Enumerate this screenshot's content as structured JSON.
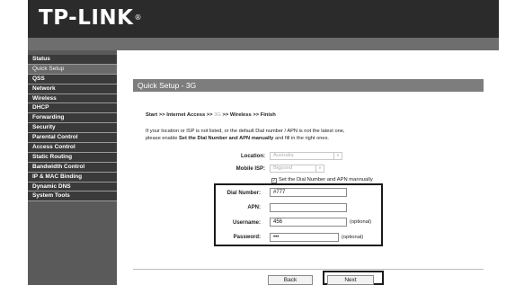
{
  "header": {
    "logo_text": "TP-LINK",
    "logo_mark": "®"
  },
  "sidebar": {
    "items": [
      {
        "label": "Status",
        "selected": false
      },
      {
        "label": "Quick Setup",
        "selected": true
      },
      {
        "label": "QSS",
        "selected": false
      },
      {
        "label": "Network",
        "selected": false
      },
      {
        "label": "Wireless",
        "selected": false
      },
      {
        "label": "DHCP",
        "selected": false
      },
      {
        "label": "Forwarding",
        "selected": false
      },
      {
        "label": "Security",
        "selected": false
      },
      {
        "label": "Parental Control",
        "selected": false
      },
      {
        "label": "Access Control",
        "selected": false
      },
      {
        "label": "Static Routing",
        "selected": false
      },
      {
        "label": "Bandwidth Control",
        "selected": false
      },
      {
        "label": "IP & MAC Binding",
        "selected": false
      },
      {
        "label": "Dynamic DNS",
        "selected": false
      },
      {
        "label": "System Tools",
        "selected": false
      }
    ]
  },
  "page": {
    "title": "Quick Setup - 3G",
    "breadcrumb": {
      "start": "Start",
      "sep1": " >> ",
      "internet": "Internet Access",
      "sep2": " >> ",
      "current": "3G",
      "sep3": " >> ",
      "wireless": "Wireless",
      "sep4": " >> ",
      "finish": "Finish"
    },
    "info_line1": "If your location or ISP is not listed, or the default Dial number / APN is not the latest one,",
    "info_line2_prefix": "please enable ",
    "info_line2_bold": "Set the Dial Number and APN manually",
    "info_line2_suffix": " and fill in the right ones."
  },
  "form": {
    "location_label": "Location:",
    "location_value": "Australia",
    "isp_label": "Mobile ISP:",
    "isp_value": "Bigpond",
    "dropdown_arrow": "∨",
    "manual_checkbox_label": "Set the Dial Number and APN mannually",
    "manual_checked": true,
    "check_mark": "✓",
    "dial_label": "Dial Number:",
    "dial_value": "#777",
    "apn_label": "APN:",
    "apn_value": "",
    "username_label": "Username:",
    "username_value": "456",
    "username_hint": "(optional)",
    "password_label": "Password:",
    "password_value": "•••",
    "password_hint": "(optional)"
  },
  "buttons": {
    "back_label": "Back",
    "next_label": "Next"
  },
  "colors": {
    "header_bg": "#2b2b2b",
    "subbar_bg": "#6e6e6e",
    "sidebar_bg": "#5a5a5a",
    "nav_item_bg": "#3a3a3a",
    "nav_selected_bg": "#6a6a6a",
    "title_bar_bg": "#7d7d7d",
    "highlight_border": "#1a1a1a"
  }
}
